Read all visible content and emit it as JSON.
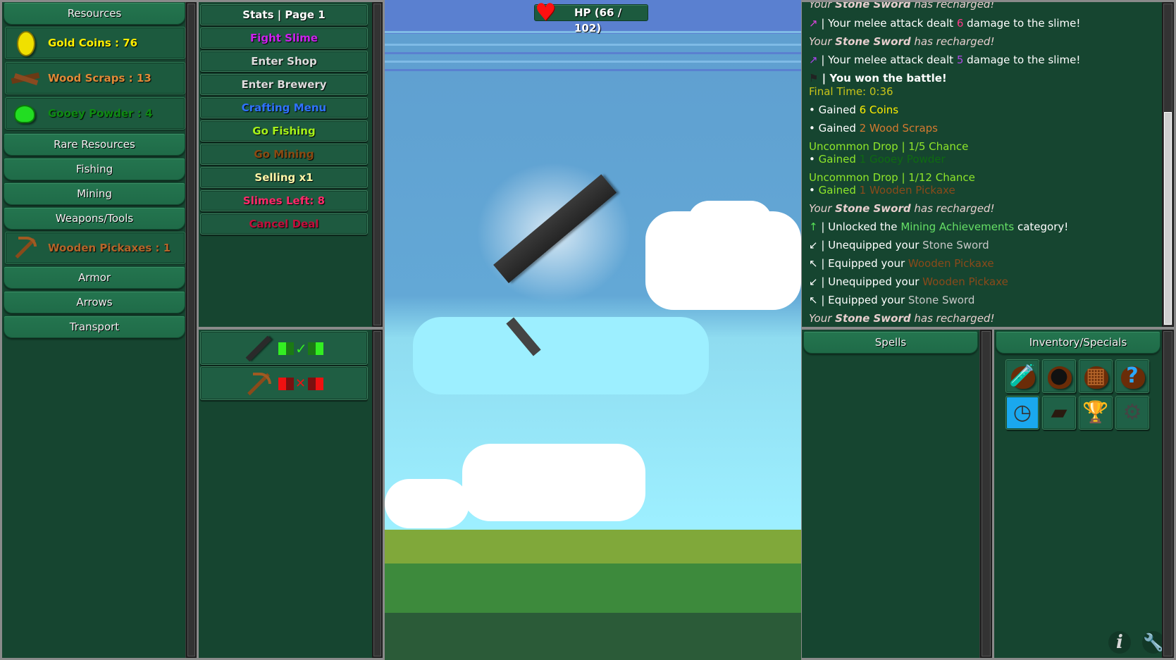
{
  "left_panel": {
    "resources_tab": "Resources",
    "resources": [
      {
        "label": "Gold Coins : 76",
        "icon": "gold-coin-icon",
        "color": "#ffee00"
      },
      {
        "label": "Wood Scraps : 13",
        "icon": "wood-scraps-icon",
        "color": "#e08a38"
      },
      {
        "label": "Gooey Powder : 4",
        "icon": "gooey-powder-icon",
        "color": "#0e8a12"
      }
    ],
    "tabs": [
      "Rare Resources",
      "Fishing",
      "Mining",
      "Weapons/Tools"
    ],
    "tools": [
      {
        "label": "Wooden Pickaxes : 1",
        "icon": "wooden-pickaxe-icon",
        "color": "#b5652a"
      }
    ],
    "tabs_after": [
      "Armor",
      "Arrows",
      "Transport"
    ]
  },
  "action_panel": {
    "buttons": [
      {
        "label": "Stats | Page 1",
        "color": "#ffffff"
      },
      {
        "label": "Fight Slime",
        "color": "#cc22ee"
      },
      {
        "label": "Enter Shop",
        "color": "#dddddd"
      },
      {
        "label": "Enter Brewery",
        "color": "#dddddd"
      },
      {
        "label": "Crafting Menu",
        "color": "#2f73ff"
      },
      {
        "label": "Go Fishing",
        "color": "#a6f21a"
      },
      {
        "label": "Go Mining",
        "color": "#8a4a12"
      },
      {
        "label": "Selling x1",
        "color": "#fff7a8"
      },
      {
        "label": "Slimes Left: 8",
        "color": "#ff2a6a"
      },
      {
        "label": "Cancel Deal",
        "color": "#c0103c"
      }
    ]
  },
  "equipment": [
    {
      "item": "Stone Sword",
      "icon": "stone-sword-icon",
      "status": "equipped",
      "status_icon": "checkmark-icon",
      "color": "#33ee22"
    },
    {
      "item": "Wooden Pickaxe",
      "icon": "wooden-pickaxe-icon",
      "status": "unequipped",
      "status_icon": "x-mark-icon",
      "color": "#ee1111"
    }
  ],
  "scene": {
    "hp_label": "HP (66 / 102)",
    "hp_current": 66,
    "hp_max": 102,
    "weapon": "Stone Sword"
  },
  "log": {
    "lines": [
      {
        "parts": [
          {
            "t": "Your ",
            "c": "it"
          },
          {
            "t": "Stone Sword",
            "c": "it bd"
          },
          {
            "t": " has recharged!",
            "c": "it"
          }
        ]
      },
      {
        "icon": "↗",
        "icon_color": "#dd44dd",
        "parts": [
          {
            "t": " | Your melee attack dealt "
          },
          {
            "t": "6",
            "color": "#ff3a8a"
          },
          {
            "t": " damage to the slime!"
          }
        ]
      },
      {
        "parts": [
          {
            "t": "Your ",
            "c": "it"
          },
          {
            "t": "Stone Sword",
            "c": "it bd"
          },
          {
            "t": " has recharged!",
            "c": "it"
          }
        ]
      },
      {
        "icon": "↗",
        "icon_color": "#aa44ee",
        "parts": [
          {
            "t": " | Your melee attack dealt "
          },
          {
            "t": "5",
            "color": "#b04ae6"
          },
          {
            "t": " damage to the slime!"
          }
        ]
      },
      {
        "icon": "⚑",
        "icon_color": "#222222",
        "parts": [
          {
            "t": " | You won the battle!",
            "c": "bd"
          }
        ]
      },
      {
        "parts": [
          {
            "t": "Final Time: 0:36",
            "color": "#c8c41a"
          }
        ]
      },
      {
        "parts": [
          {
            "t": "• Gained "
          },
          {
            "t": "6 Coins",
            "color": "#ffee00"
          }
        ]
      },
      {
        "parts": [
          {
            "t": "• Gained "
          },
          {
            "t": "2 Wood Scraps",
            "color": "#d57a30"
          }
        ]
      },
      {
        "parts": [
          {
            "t": "Uncommon Drop | 1/5 Chance",
            "color": "#8ee62a"
          }
        ]
      },
      {
        "parts": [
          {
            "t": "• ",
            "color": "#ffffff"
          },
          {
            "t": "Gained ",
            "color": "#8ee62a"
          },
          {
            "t": "1 Gooey Powder",
            "color": "#0f6a12"
          }
        ]
      },
      {
        "parts": [
          {
            "t": "Uncommon Drop | 1/12 Chance",
            "color": "#8ee62a"
          }
        ]
      },
      {
        "parts": [
          {
            "t": "• ",
            "color": "#ffffff"
          },
          {
            "t": "Gained ",
            "color": "#8ee62a"
          },
          {
            "t": "1 Wooden Pickaxe",
            "color": "#8a4a1a"
          }
        ]
      },
      {
        "parts": [
          {
            "t": "Your ",
            "c": "it"
          },
          {
            "t": "Stone Sword",
            "c": "it bd"
          },
          {
            "t": " has recharged!",
            "c": "it"
          }
        ]
      },
      {
        "icon": "↑",
        "icon_color": "#55dd55",
        "parts": [
          {
            "t": " | Unlocked the "
          },
          {
            "t": "Mining Achievements",
            "color": "#66e066"
          },
          {
            "t": " category!"
          }
        ]
      },
      {
        "icon": "↙",
        "icon_color": "#ffffff",
        "parts": [
          {
            "t": " | Unequipped your "
          },
          {
            "t": "Stone Sword",
            "color": "#c8c8c8"
          }
        ]
      },
      {
        "icon": "↖",
        "icon_color": "#ffffff",
        "parts": [
          {
            "t": " | Equipped your "
          },
          {
            "t": "Wooden Pickaxe",
            "color": "#8a4a1a"
          }
        ]
      },
      {
        "icon": "↙",
        "icon_color": "#ffffff",
        "parts": [
          {
            "t": " | Unequipped your "
          },
          {
            "t": "Wooden Pickaxe",
            "color": "#8a4a1a"
          }
        ]
      },
      {
        "icon": "↖",
        "icon_color": "#ffffff",
        "parts": [
          {
            "t": " | Equipped your "
          },
          {
            "t": "Stone Sword",
            "color": "#c8c8c8"
          }
        ]
      },
      {
        "parts": [
          {
            "t": "Your ",
            "c": "it"
          },
          {
            "t": "Stone Sword",
            "c": "it bd"
          },
          {
            "t": " has recharged!",
            "c": "it"
          }
        ]
      }
    ],
    "scroll_position": 1.0
  },
  "spells": {
    "tab": "Spells"
  },
  "inventory": {
    "tab": "Inventory/Specials",
    "slots": [
      {
        "name": "potion-bag-icon"
      },
      {
        "name": "bomb-bag-icon"
      },
      {
        "name": "crate-bag-icon"
      },
      {
        "name": "mystery-bag-icon"
      },
      {
        "name": "stopwatch-icon"
      },
      {
        "name": "journal-icon"
      },
      {
        "name": "trophy-icon"
      },
      {
        "name": "settings-gear-icon"
      }
    ]
  },
  "corner_buttons": {
    "info": "i",
    "tools": "wrench"
  }
}
